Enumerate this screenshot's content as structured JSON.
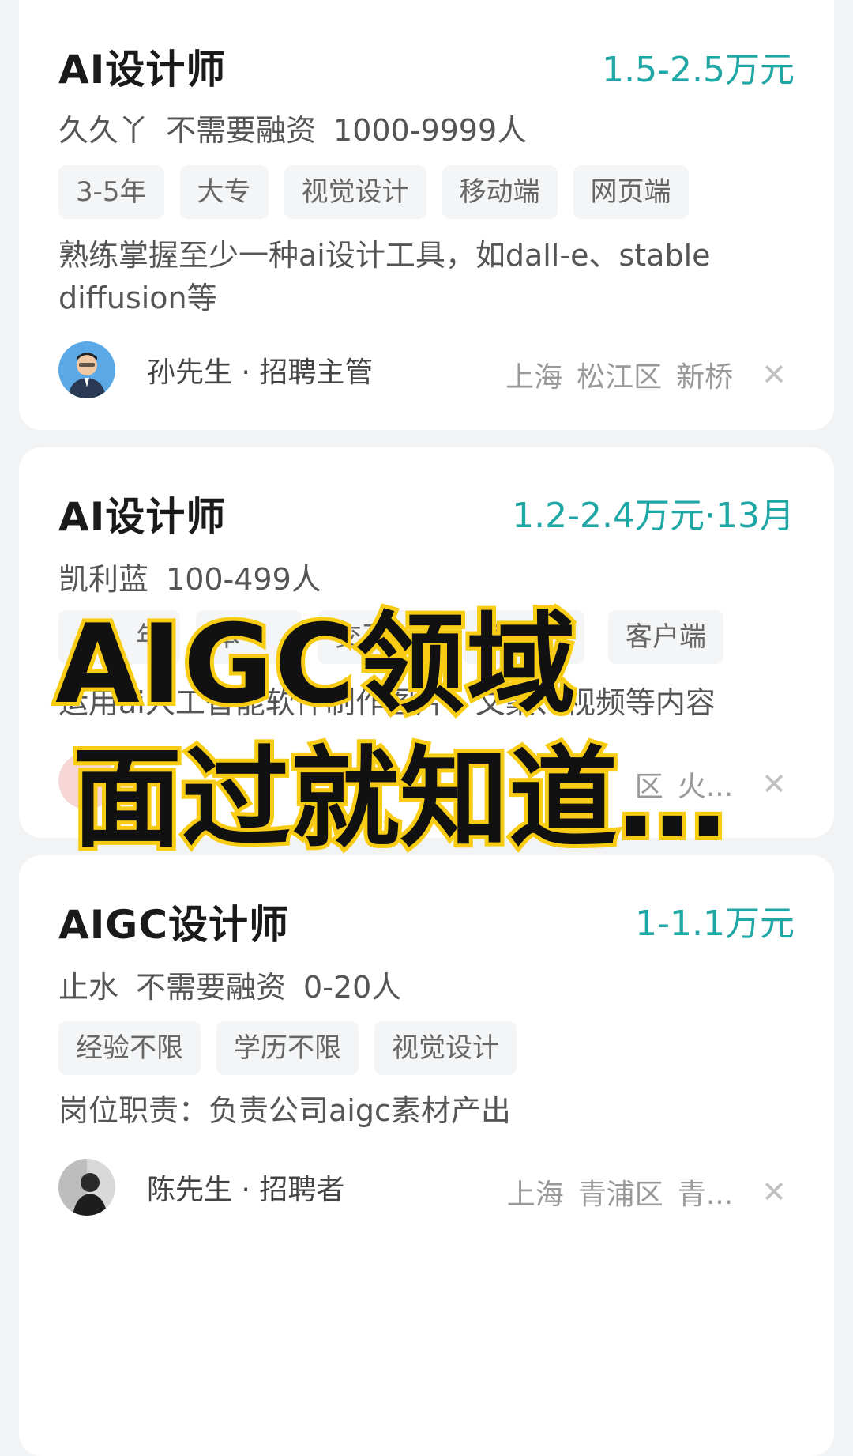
{
  "jobs": [
    {
      "title": "AI设计师",
      "salary": "1.5-2.5万元",
      "company": [
        "久久丫",
        "不需要融资",
        "1000-9999人"
      ],
      "tags": [
        "3-5年",
        "大专",
        "视觉设计",
        "移动端",
        "网页端"
      ],
      "desc": "熟练掌握至少一种ai设计工具，如dall-e、stable diffusion等",
      "recruiter": "孙先生 · 招聘主管",
      "location": [
        "上海",
        "松江区",
        "新桥"
      ]
    },
    {
      "title": "AI设计师",
      "salary": "1.2-2.4万元·13月",
      "company": [
        "凯利蓝",
        "100-499人"
      ],
      "tags": [
        "年",
        "本",
        "交互",
        "移",
        "客户端"
      ],
      "desc": "运用ai人工智能软件制作图片、文案、视频等内容",
      "recruiter": "",
      "location": [
        "区",
        "火..."
      ]
    },
    {
      "title": "AIGC设计师",
      "salary": "1-1.1万元",
      "company": [
        "止水",
        "不需要融资",
        "0-20人"
      ],
      "tags": [
        "经验不限",
        "学历不限",
        "视觉设计"
      ],
      "desc": "岗位职责：负责公司aigc素材产出",
      "recruiter": "陈先生 · 招聘者",
      "location": [
        "上海",
        "青浦区",
        "青..."
      ]
    }
  ],
  "overlay": {
    "line1": "AIGC领域",
    "line2": "面过就知道…"
  },
  "colors": {
    "salary": "#1ea7a4",
    "overlay_stroke": "#f7cc12",
    "background": "#f2f3f5"
  }
}
